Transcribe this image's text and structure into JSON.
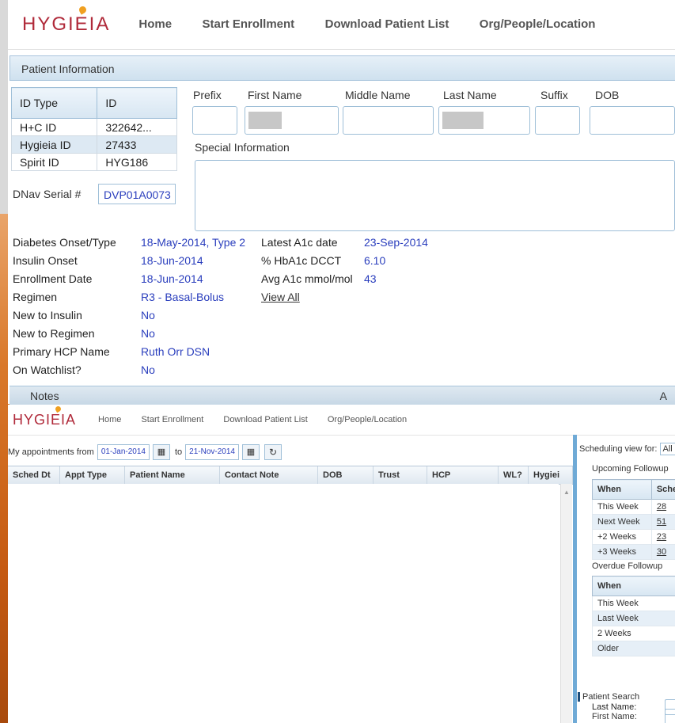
{
  "top_window": {
    "brand": "HYGIEIA",
    "nav": [
      "Home",
      "Start Enrollment",
      "Download Patient List",
      "Org/People/Location"
    ],
    "panel_title": "Patient Information",
    "id_table": {
      "headers": [
        "ID Type",
        "ID"
      ],
      "rows": [
        {
          "type": "H+C ID",
          "id": "322642..."
        },
        {
          "type": "Hygieia ID",
          "id": "27433"
        },
        {
          "type": "Spirit ID",
          "id": "HYG186"
        }
      ]
    },
    "dnav_label": "DNav Serial #",
    "dnav_value": "DVP01A0073",
    "name_fields": {
      "prefix": "Prefix",
      "first": "First Name",
      "middle": "Middle Name",
      "last": "Last Name",
      "suffix": "Suffix",
      "dob": "DOB"
    },
    "special_info_label": "Special Information",
    "details": [
      {
        "label": "Diabetes Onset/Type",
        "value": "18-May-2014, Type 2"
      },
      {
        "label": "Insulin Onset",
        "value": "18-Jun-2014"
      },
      {
        "label": "Enrollment Date",
        "value": "18-Jun-2014"
      },
      {
        "label": "Regimen",
        "value": "R3 - Basal-Bolus"
      },
      {
        "label": "New to Insulin",
        "value": "No"
      },
      {
        "label": "New to Regimen",
        "value": "No"
      },
      {
        "label": "Primary HCP Name",
        "value": "Ruth Orr DSN"
      },
      {
        "label": "On Watchlist?",
        "value": "No"
      }
    ],
    "a1c": [
      {
        "label": "Latest A1c date",
        "value": "23-Sep-2014"
      },
      {
        "label": "% HbA1c DCCT",
        "value": "6.10"
      },
      {
        "label": "Avg A1c mmol/mol",
        "value": "43"
      }
    ],
    "view_all": "View All",
    "notes_label": "Notes",
    "notes_right": "A"
  },
  "bottom_window": {
    "brand": "HYGIEIA",
    "nav": [
      "Home",
      "Start Enrollment",
      "Download Patient List",
      "Org/People/Location"
    ],
    "appt_label": "My appointments from",
    "from_date": "01-Jan-2014",
    "to_label": "to",
    "to_date": "21-Nov-2014",
    "columns": [
      "Sched Dt",
      "Appt Type",
      "Patient Name",
      "Contact Note",
      "DOB",
      "Trust",
      "HCP",
      "WL?",
      "Hygiei"
    ],
    "scheduling_view_label": "Scheduling view for:",
    "scheduling_view_value": "All",
    "upcoming_title": "Upcoming Followup",
    "upcoming_headers": [
      "When",
      "Sche"
    ],
    "upcoming_rows": [
      {
        "when": "This Week",
        "count": "28"
      },
      {
        "when": "Next Week",
        "count": "51"
      },
      {
        "when": "+2 Weeks",
        "count": "23"
      },
      {
        "when": "+3 Weeks",
        "count": "30"
      }
    ],
    "overdue_title": "Overdue Followup",
    "overdue_header": "When",
    "overdue_rows": [
      "This Week",
      "Last Week",
      "2 Weeks",
      "Older"
    ],
    "patient_search_title": "Patient Search",
    "first_name_label": "First Name:",
    "last_name_label": "Last Name:"
  }
}
